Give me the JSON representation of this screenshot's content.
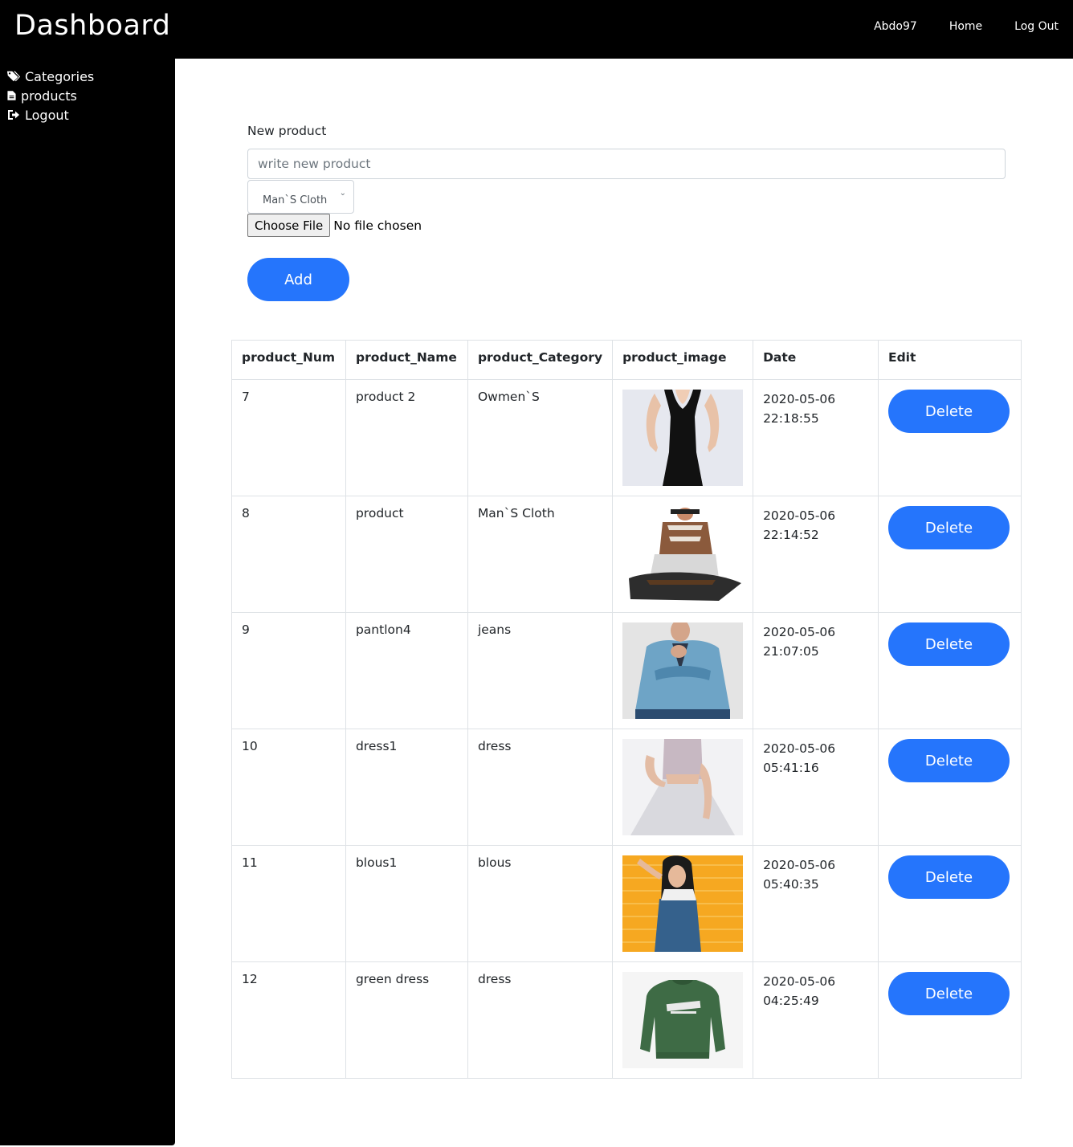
{
  "header": {
    "brand": "Dashboard",
    "nav": [
      "Abdo97",
      "Home",
      "Log Out"
    ]
  },
  "sidebar": {
    "items": [
      {
        "label": "Categories",
        "icon": "tags-icon"
      },
      {
        "label": "products",
        "icon": "file-icon"
      },
      {
        "label": "Logout",
        "icon": "sign-out-icon"
      }
    ]
  },
  "form": {
    "label": "New product",
    "placeholder": "write new product",
    "category_selected": "Man`S Cloth",
    "file_button": "Choose File",
    "file_status": "No file chosen",
    "add_label": "Add"
  },
  "table": {
    "headers": [
      "product_Num",
      "product_Name",
      "product_Category",
      "product_image",
      "Date",
      "Edit"
    ],
    "rows": [
      {
        "num": "7",
        "name": "product 2",
        "category": "Owmen`S",
        "image": "black-dress-photo",
        "date": "2020-05-06",
        "time": "22:18:55",
        "action": "Delete"
      },
      {
        "num": "8",
        "name": "product",
        "category": "Man`S Cloth",
        "image": "plaid-shirt-bag-photo",
        "date": "2020-05-06",
        "time": "22:14:52",
        "action": "Delete"
      },
      {
        "num": "9",
        "name": "pantlon4",
        "category": "jeans",
        "image": "denim-jacket-photo",
        "date": "2020-05-06",
        "time": "21:07:05",
        "action": "Delete"
      },
      {
        "num": "10",
        "name": "dress1",
        "category": "dress",
        "image": "sequin-dress-photo",
        "date": "2020-05-06",
        "time": "05:41:16",
        "action": "Delete"
      },
      {
        "num": "11",
        "name": "blous1",
        "category": "blous",
        "image": "overalls-woman-photo",
        "date": "2020-05-06",
        "time": "05:40:35",
        "action": "Delete"
      },
      {
        "num": "12",
        "name": "green dress",
        "category": "dress",
        "image": "green-sweatshirt-photo",
        "date": "2020-05-06",
        "time": "04:25:49",
        "action": "Delete"
      }
    ]
  },
  "colors": {
    "accent": "#2575fc",
    "sidebar": "#000000",
    "topbar": "#000000"
  }
}
